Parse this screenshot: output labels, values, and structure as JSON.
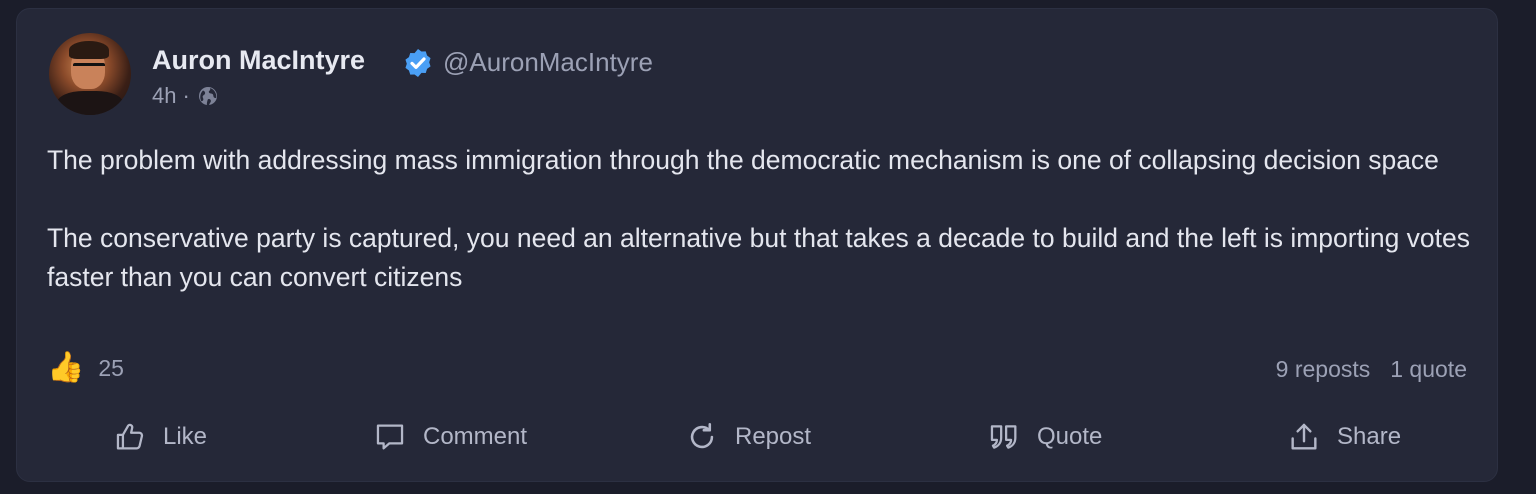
{
  "post": {
    "author_name": "Auron MacIntyre",
    "author_handle": "@AuronMacIntyre",
    "time": "4h",
    "separator": "·",
    "paragraphs": [
      "The problem with addressing mass immigration through the democratic mechanism is one of collapsing decision space",
      "The conservative party is captured, you need an alternative but that takes a decade to build and the left is importing votes faster than you can convert citizens"
    ],
    "reaction_emoji": "👍",
    "reaction_count": "25",
    "reposts": "9 reposts",
    "quotes": "1 quote"
  },
  "actions": {
    "like": "Like",
    "comment": "Comment",
    "repost": "Repost",
    "quote": "Quote",
    "share": "Share"
  },
  "colors": {
    "background": "#1b1d2a",
    "card": "#252838",
    "verified": "#4a9ff5",
    "text_primary": "#e7e9f1",
    "text_secondary": "#9ca1b5"
  }
}
